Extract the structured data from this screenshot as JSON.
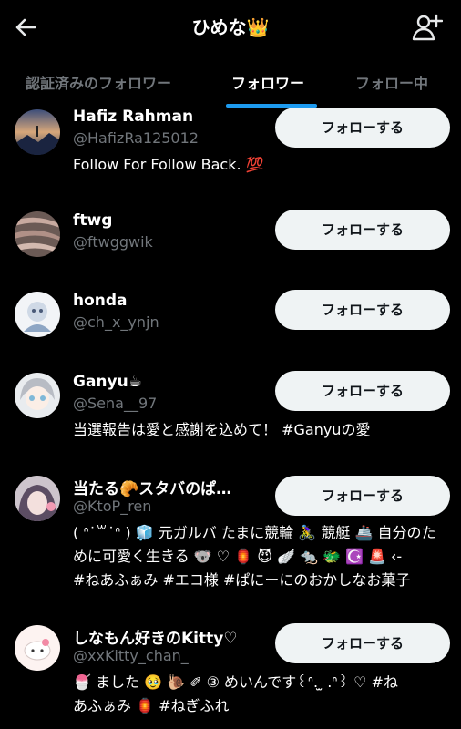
{
  "header": {
    "title": "ひめな",
    "title_emoji": "👑"
  },
  "tabs": [
    {
      "label": "認証済みのフォロワー",
      "active": false
    },
    {
      "label": "フォロワー",
      "active": true
    },
    {
      "label": "フォロー中",
      "active": false
    }
  ],
  "colors": {
    "accent": "#1d9bf0",
    "button_bg": "#eff3f4",
    "muted": "#71767b"
  },
  "followers": [
    {
      "name": "Hafiz Rahman",
      "handle": "@HafizRa125012",
      "button": "フォローする",
      "bio": [
        "Follow For Follow Back. 💯"
      ]
    },
    {
      "name": "ftwg",
      "handle": "@ftwggwik",
      "button": "フォローする",
      "bio": []
    },
    {
      "name": "honda",
      "handle": "@ch_x_ynjn",
      "button": "フォローする",
      "bio": []
    },
    {
      "name": "Ganyu☕",
      "handle": "@Sena__97",
      "button": "フォローする",
      "bio": [
        "当選報告は愛と感謝を込めて！ #Ganyuの愛"
      ]
    },
    {
      "name": "当たる🥐スタバのぱ…",
      "handle": "@KtoP_ren",
      "button": "フォローする",
      "bio": [
        "( ᐢ˙꒳˙ᐢ ) 🧊 元ガルバ たまに競輪 🚴‍♀️ 競艇 🚢 自分のた",
        "めに可愛く生きる 🐨 ♡ 🏮 😈 🪽 🐀 🐲 ☪️ 🚨 ‹-",
        "#ねあふぁみ #エコ様 #ぱにーにのおかしなお菓子"
      ]
    },
    {
      "name": "しなもん好きのKitty♡",
      "handle": "@xxKitty_chan_",
      "button": "フォローする",
      "bio": [
        "🍧 ました 🥹 🐌 ✐ ③ めいんです꒰ᐢ. ̫ .ᐢ꒱ ♡ #ね",
        "あふぁみ 🏮 #ねぎふれ"
      ]
    }
  ]
}
